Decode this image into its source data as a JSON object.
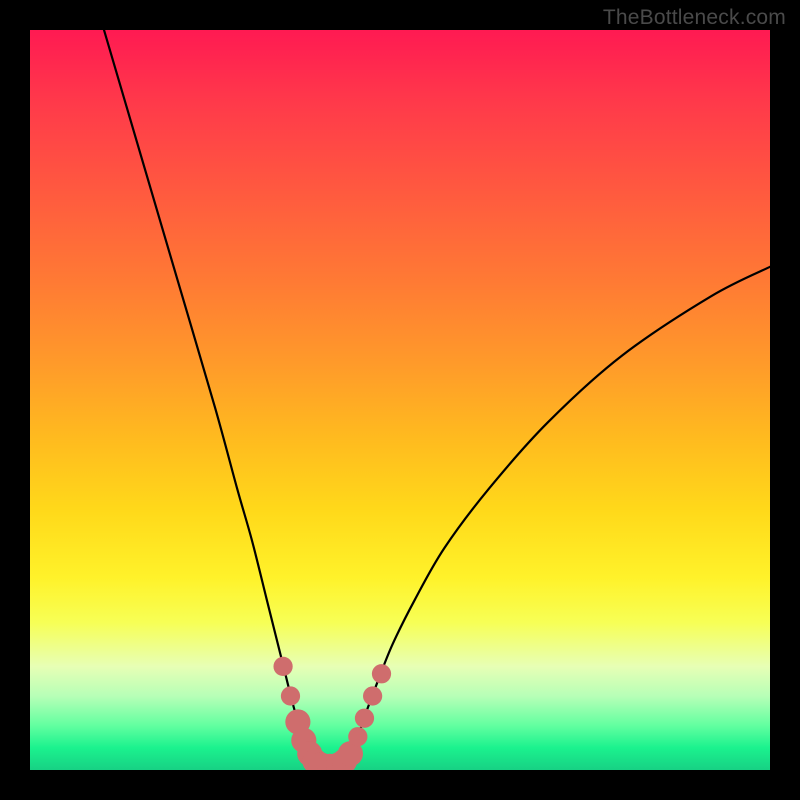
{
  "watermark": "TheBottleneck.com",
  "colors": {
    "curve_stroke": "#000000",
    "marker_fill": "#cf6d6d",
    "marker_stroke": "#cf6d6d",
    "gradient_top": "#ff1a52",
    "gradient_bottom": "#17d184",
    "frame": "#000000"
  },
  "chart_data": {
    "type": "line",
    "title": "",
    "xlabel": "",
    "ylabel": "",
    "xlim": [
      0,
      100
    ],
    "ylim": [
      0,
      100
    ],
    "grid": false,
    "legend": false,
    "series": [
      {
        "name": "left-curve",
        "x": [
          10,
          15,
          20,
          25,
          28,
          30,
          32,
          33.5,
          34.5,
          35.5,
          36.5,
          37.3,
          38,
          38.5
        ],
        "y": [
          100,
          83,
          66,
          49,
          38,
          31,
          23,
          17,
          13,
          9,
          5.5,
          3,
          1.4,
          0.6
        ]
      },
      {
        "name": "right-curve",
        "x": [
          42.5,
          43.3,
          44.3,
          45.5,
          47,
          49,
          52,
          56,
          62,
          70,
          80,
          92,
          100
        ],
        "y": [
          0.6,
          2,
          4.5,
          8,
          12,
          17,
          23,
          30,
          38,
          47,
          56,
          64,
          68
        ]
      },
      {
        "name": "bottom-flat",
        "x": [
          38.5,
          40.5,
          42.5
        ],
        "y": [
          0.6,
          0.5,
          0.6
        ]
      }
    ],
    "markers": [
      {
        "x": 34.2,
        "y": 14.0,
        "r": 1.3
      },
      {
        "x": 35.2,
        "y": 10.0,
        "r": 1.3
      },
      {
        "x": 36.2,
        "y": 6.5,
        "r": 1.7
      },
      {
        "x": 37.0,
        "y": 4.0,
        "r": 1.7
      },
      {
        "x": 37.8,
        "y": 2.2,
        "r": 1.7
      },
      {
        "x": 38.5,
        "y": 1.2,
        "r": 1.7
      },
      {
        "x": 39.3,
        "y": 0.7,
        "r": 1.7
      },
      {
        "x": 40.5,
        "y": 0.5,
        "r": 1.7
      },
      {
        "x": 41.7,
        "y": 0.7,
        "r": 1.7
      },
      {
        "x": 42.5,
        "y": 1.2,
        "r": 1.7
      },
      {
        "x": 43.3,
        "y": 2.2,
        "r": 1.7
      },
      {
        "x": 44.3,
        "y": 4.5,
        "r": 1.3
      },
      {
        "x": 45.2,
        "y": 7.0,
        "r": 1.3
      },
      {
        "x": 46.3,
        "y": 10.0,
        "r": 1.3
      },
      {
        "x": 47.5,
        "y": 13.0,
        "r": 1.3
      }
    ],
    "annotations": []
  }
}
